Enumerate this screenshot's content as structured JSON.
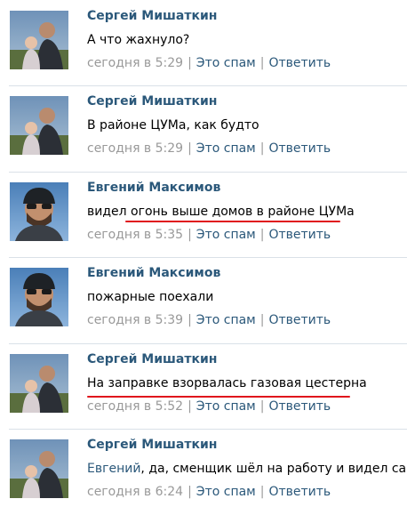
{
  "actions": {
    "spam_label": "Это спам",
    "reply_label": "Ответить"
  },
  "comments": [
    {
      "author": "Сергей Мишаткин",
      "avatar_icon": "user-photo-sergey",
      "text": "А что жахнуло?",
      "time": "сегодня в 5:29"
    },
    {
      "author": "Сергей Мишаткин",
      "avatar_icon": "user-photo-sergey",
      "text": "В районе ЦУМа, как будто",
      "time": "сегодня в 5:29"
    },
    {
      "author": "Евгений Максимов",
      "avatar_icon": "user-photo-evgeny",
      "text_prefix": "видел ",
      "text_highlighted": "огонь выше домов в районе ЦУМа",
      "time": "сегодня в 5:35"
    },
    {
      "author": "Евгений Максимов",
      "avatar_icon": "user-photo-evgeny",
      "text": "пожарные поехали",
      "time": "сегодня в 5:39"
    },
    {
      "author": "Сергей Мишаткин",
      "avatar_icon": "user-photo-sergey",
      "text_highlighted": "На заправке взорвалась газовая цестерна",
      "time": "сегодня в 5:52"
    },
    {
      "author": "Сергей Мишаткин",
      "avatar_icon": "user-photo-sergey",
      "mention": "Евгений",
      "text": ", да, сменщик шёл на работу и видел сам",
      "time": "сегодня в 6:24"
    }
  ],
  "colors": {
    "link": "#2b587a",
    "meta": "#999999",
    "highlight_underline": "#e0131c",
    "divider": "#dae1e8"
  }
}
